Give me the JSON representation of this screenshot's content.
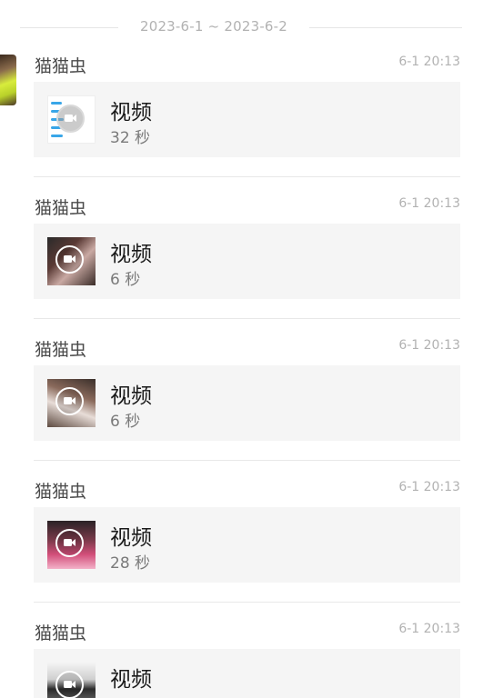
{
  "date_range": "2023-6-1 ~ 2023-6-2",
  "messages": [
    {
      "sender": "猫猫虫",
      "time": "6-1 20:13",
      "type_label": "视频",
      "duration": "32 秒"
    },
    {
      "sender": "猫猫虫",
      "time": "6-1 20:13",
      "type_label": "视频",
      "duration": "6 秒"
    },
    {
      "sender": "猫猫虫",
      "time": "6-1 20:13",
      "type_label": "视频",
      "duration": "6 秒"
    },
    {
      "sender": "猫猫虫",
      "time": "6-1 20:13",
      "type_label": "视频",
      "duration": "28 秒"
    },
    {
      "sender": "猫猫虫",
      "time": "6-1 20:13",
      "type_label": "视频",
      "duration": ""
    }
  ],
  "icons": {
    "play": "video-camera-icon"
  },
  "colors": {
    "card_bg": "#f5f5f5",
    "muted_text": "#b2b2b2",
    "divider": "#e8e8e8"
  }
}
